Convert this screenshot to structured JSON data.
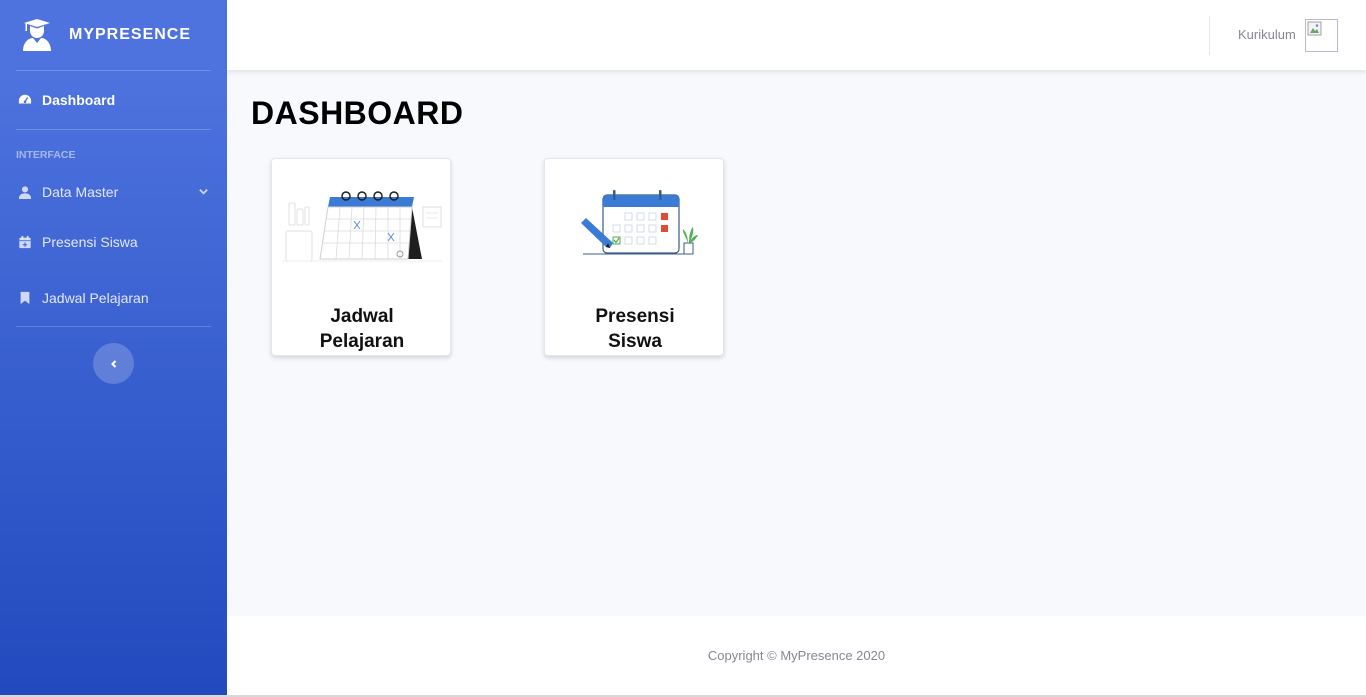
{
  "brand": {
    "name": "MYPRESENCE",
    "icon": "user-graduate-icon"
  },
  "sidebar": {
    "dashboard_label": "Dashboard",
    "heading": "INTERFACE",
    "items": [
      {
        "label": "Data Master",
        "icon": "user-icon",
        "has_submenu": true
      },
      {
        "label": "Presensi Siswa",
        "icon": "calendar-plus-icon"
      },
      {
        "label": "Jadwal Pelajaran",
        "icon": "bookmark-icon"
      }
    ]
  },
  "topbar": {
    "user_name": "Kurikulum"
  },
  "main": {
    "title": "DASHBOARD",
    "cards": [
      {
        "label": "Jadwal Pelajaran"
      },
      {
        "label": "Presensi Siswa"
      }
    ]
  },
  "footer": {
    "copyright": "Copyright © MyPresence 2020"
  },
  "colors": {
    "sidebar_top": "#4e73df",
    "sidebar_bottom": "#224abe",
    "background": "#f8f9fc"
  }
}
